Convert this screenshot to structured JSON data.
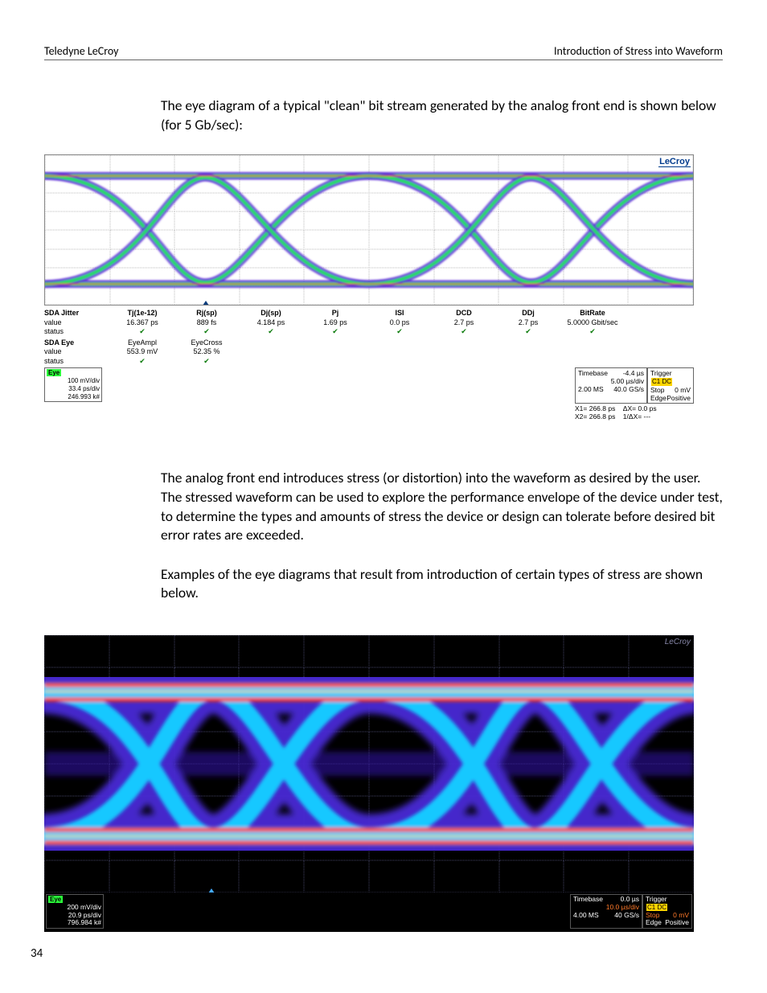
{
  "header": {
    "left": "Teledyne LeCroy",
    "right": "Introduction of Stress into Waveform"
  },
  "para1": "The eye diagram of a typical \"clean\" bit stream generated by the analog front end is shown below (for 5 Gb/sec):",
  "para2": "The analog front end introduces stress (or distortion) into the waveform as desired by the user. The stressed waveform can be used to explore the performance envelope of the device under test, to determine the types and amounts of stress the device or design can tolerate before desired bit error rates are exceeded.",
  "para3": "Examples of the eye diagrams that result from introduction of certain types of stress are shown below.",
  "page_number": "34",
  "fig1": {
    "brand": "LeCroy",
    "jitter": {
      "title": "SDA Jitter",
      "row_labels": [
        "value",
        "status"
      ],
      "cols": [
        {
          "name": "Tj(1e-12)",
          "value": "16.367 ps"
        },
        {
          "name": "Rj(sp)",
          "value": "889 fs"
        },
        {
          "name": "Dj(sp)",
          "value": "4.184 ps"
        },
        {
          "name": "Pj",
          "value": "1.69 ps"
        },
        {
          "name": "ISI",
          "value": "0.0 ps"
        },
        {
          "name": "DCD",
          "value": "2.7 ps"
        },
        {
          "name": "DDj",
          "value": "2.7 ps"
        },
        {
          "name": "BitRate",
          "value": "5.0000 Gbit/sec"
        }
      ],
      "status_mark": "✔"
    },
    "eye": {
      "title": "SDA Eye",
      "row_labels": [
        "value",
        "status"
      ],
      "cols": [
        {
          "name": "EyeAmpl",
          "value": "553.9 mV"
        },
        {
          "name": "EyeCross",
          "value": "52.35 %"
        }
      ],
      "status_mark": "✔"
    },
    "badge": {
      "title": "Eye",
      "l1": "100 mV/div",
      "l2": "33.4 ps/div",
      "l3": "246.993 k#"
    },
    "timebase": {
      "title": "Timebase",
      "r1a": "-4.4 µs",
      "r2a": "",
      "r2b": "5.00 µs/div",
      "r3a": "2.00 MS",
      "r3b": "40.0 GS/s"
    },
    "trigger": {
      "title": "Trigger",
      "badge": "C1 DC",
      "r2a": "Stop",
      "r2b": "0 mV",
      "r3a": "Edge",
      "r3b": "Positive"
    },
    "cursors": {
      "x1": "X1= 266.8 ps",
      "dx": "ΔX= 0.0 ps",
      "x2": "X2= 266.8 ps",
      "inv": "1/ΔX=   ---"
    }
  },
  "fig2": {
    "brand": "LeCroy",
    "badge": {
      "title": "Eye",
      "l1": "200 mV/div",
      "l2": "20.9 ps/div",
      "l3": "796.984 k#"
    },
    "timebase": {
      "title": "Timebase",
      "r1a": "0.0 µs",
      "r2b": "10.0 µs/div",
      "r3a": "4.00 MS",
      "r3b": "40 GS/s"
    },
    "trigger": {
      "title": "Trigger",
      "badge": "C1 DC",
      "r2a": "Stop",
      "r2b": "0 mV",
      "r3a": "Edge",
      "r3b": "Positive"
    }
  },
  "chart_data": [
    {
      "type": "eye-diagram",
      "title": "Clean 5 Gb/s eye diagram",
      "bit_rate_gbps": 5.0,
      "vertical_scale": "100 mV/div",
      "horizontal_scale": "33.4 ps/div",
      "eye_amplitude_mV": 553.9,
      "eye_crossing_pct": 52.35,
      "jitter": {
        "Tj_1e-12_ps": 16.367,
        "Rj_sp_fs": 889,
        "Dj_sp_ps": 4.184,
        "Pj_ps": 1.69,
        "ISI_ps": 0.0,
        "DCD_ps": 2.7,
        "DDj_ps": 2.7
      },
      "timebase": {
        "offset_us": -4.4,
        "per_div_us": 5.0,
        "record": "2.00 MS",
        "sample_rate": "40.0 GS/s"
      },
      "cursors": {
        "X1_ps": 266.8,
        "X2_ps": 266.8,
        "dX_ps": 0.0
      }
    },
    {
      "type": "eye-diagram",
      "title": "Stressed eye diagram",
      "vertical_scale": "200 mV/div",
      "horizontal_scale": "20.9 ps/div",
      "timebase": {
        "offset_us": 0.0,
        "per_div_us": 10.0,
        "record": "4.00 MS",
        "sample_rate": "40 GS/s"
      }
    }
  ]
}
